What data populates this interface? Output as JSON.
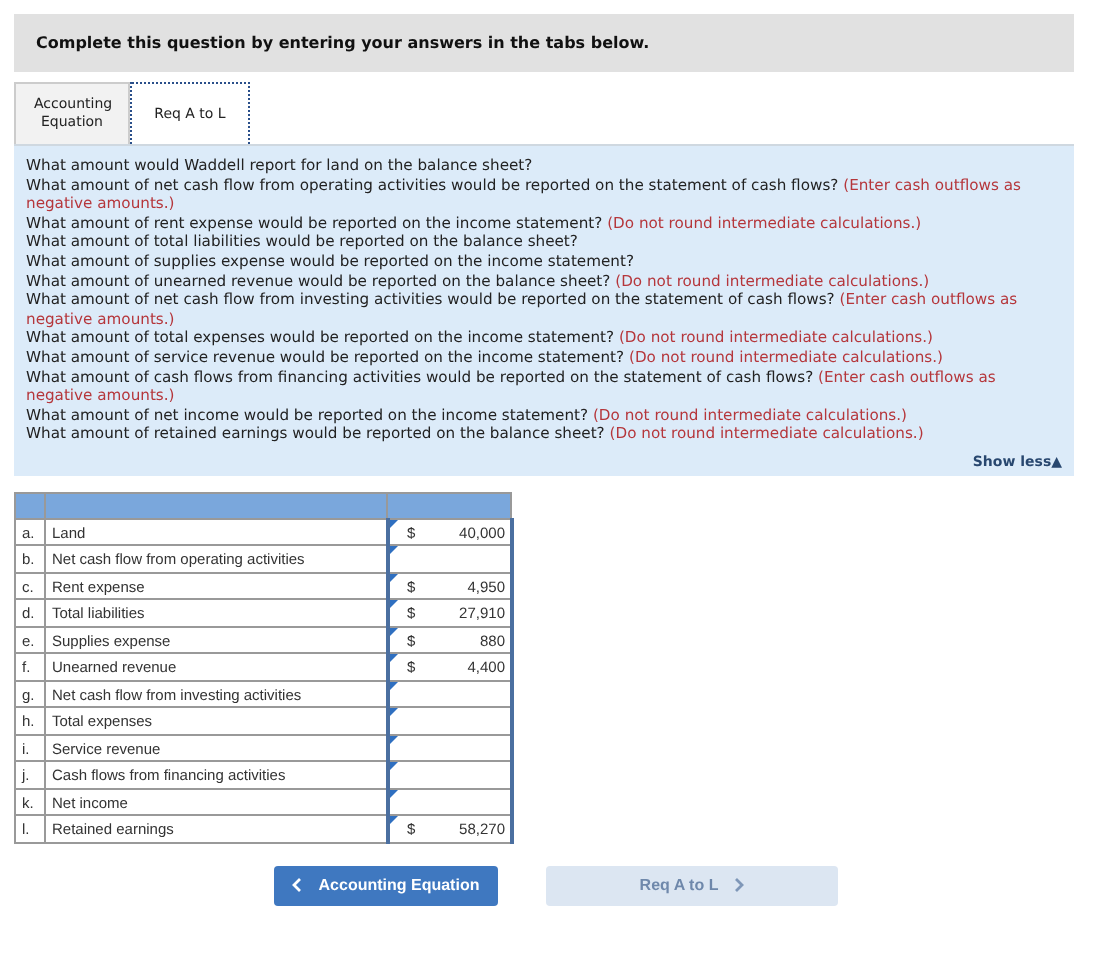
{
  "instruction": "Complete this question by entering your answers in the tabs below.",
  "tabs": [
    {
      "label": "Accounting Equation",
      "selected": false
    },
    {
      "label": "Req A to L",
      "selected": true
    }
  ],
  "questions": [
    {
      "text": "What amount would Waddell report for land on the balance sheet?"
    },
    {
      "text": "What amount of net cash flow from operating activities would be reported on the statement of cash flows?",
      "note": "(Enter cash outflows as negative amounts.)"
    },
    {
      "text": "What amount of rent expense would be reported on the income statement?",
      "note": "(Do not round intermediate calculations.)"
    },
    {
      "text": "What amount of total liabilities would be reported on the balance sheet?"
    },
    {
      "text": "What amount of supplies expense would be reported on the income statement?"
    },
    {
      "text": "What amount of unearned revenue would be reported on the balance sheet?",
      "note": "(Do not round intermediate calculations.)"
    },
    {
      "text": "What amount of net cash flow from investing activities would be reported on the statement of cash flows?",
      "note": "(Enter cash outflows as negative amounts.)"
    },
    {
      "text": "What amount of total expenses would be reported on the income statement?",
      "note": "(Do not round intermediate calculations.)"
    },
    {
      "text": "What amount of service revenue would be reported on the income statement?",
      "note": "(Do not round intermediate calculations.)"
    },
    {
      "text": "What amount of cash flows from financing activities would be reported on the statement of cash flows?",
      "note": "(Enter cash outflows as negative amounts.)"
    },
    {
      "text": "What amount of net income would be reported on the income statement?",
      "note": "(Do not round intermediate calculations.)"
    },
    {
      "text": "What amount of retained earnings would be reported on the balance sheet?",
      "note": "(Do not round intermediate calculations.)"
    }
  ],
  "show_less": "Show less▲",
  "table": {
    "rows": [
      {
        "letter": "a.",
        "label": "Land",
        "currency": "$",
        "value": "40,000"
      },
      {
        "letter": "b.",
        "label": "Net cash flow from operating activities"
      },
      {
        "letter": "c.",
        "label": "Rent expense",
        "currency": "$",
        "value": "4,950"
      },
      {
        "letter": "d.",
        "label": "Total liabilities",
        "currency": "$",
        "value": "27,910"
      },
      {
        "letter": "e.",
        "label": "Supplies expense",
        "currency": "$",
        "value": "880"
      },
      {
        "letter": "f.",
        "label": "Unearned revenue",
        "currency": "$",
        "value": "4,400"
      },
      {
        "letter": "g.",
        "label": "Net cash flow from investing activities"
      },
      {
        "letter": "h.",
        "label": "Total expenses"
      },
      {
        "letter": "i.",
        "label": "Service revenue"
      },
      {
        "letter": "j.",
        "label": "Cash flows from financing activities"
      },
      {
        "letter": "k.",
        "label": "Net income"
      },
      {
        "letter": "l.",
        "label": "Retained earnings",
        "currency": "$",
        "value": "58,270"
      }
    ]
  },
  "nav": [
    {
      "label": "Accounting Equation",
      "kind": "prev",
      "disabled": false
    },
    {
      "label": "Req A to L",
      "kind": "next",
      "disabled": true
    }
  ]
}
